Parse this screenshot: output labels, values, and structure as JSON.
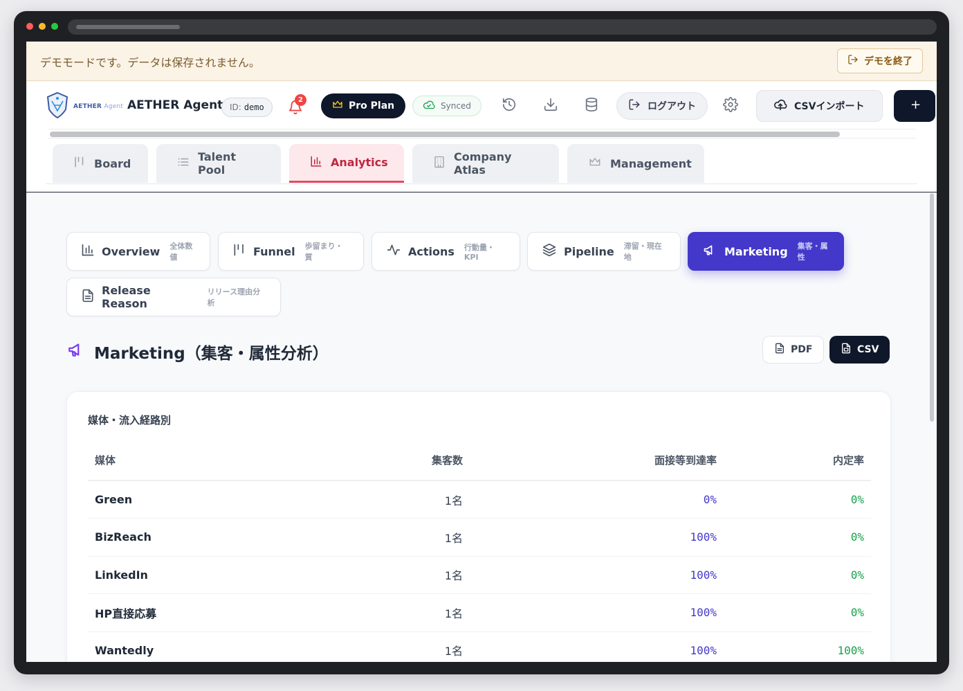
{
  "demo_banner": {
    "message": "デモモードです。データは保存されません。",
    "exit_label": "デモを終了"
  },
  "header": {
    "logo_text": "AETHER",
    "logo_sub": "Agent",
    "app_name": "AETHER Agent",
    "id_label": "ID:",
    "id_value": "demo",
    "notification_count": "2",
    "plan_label": "Pro Plan",
    "sync_label": "Synced",
    "logout_label": "ログアウト",
    "csv_import_label": "CSVインポート"
  },
  "main_tabs": [
    {
      "label": "Board",
      "icon": "columns-icon"
    },
    {
      "label": "Talent Pool",
      "icon": "list-icon"
    },
    {
      "label": "Analytics",
      "icon": "bar-chart-icon",
      "active": true
    },
    {
      "label": "Company Atlas",
      "icon": "building-icon"
    },
    {
      "label": "Management",
      "icon": "crown-icon"
    }
  ],
  "sub_tabs": [
    {
      "label": "Overview",
      "sub": "全体数値",
      "icon": "bar-chart-icon"
    },
    {
      "label": "Funnel",
      "sub": "歩留まり・質",
      "icon": "columns-icon"
    },
    {
      "label": "Actions",
      "sub": "行動量・KPI",
      "icon": "activity-icon"
    },
    {
      "label": "Pipeline",
      "sub": "滞留・現在地",
      "icon": "layers-icon"
    },
    {
      "label": "Marketing",
      "sub": "集客・属性",
      "icon": "megaphone-icon",
      "active": true
    },
    {
      "label": "Release Reason",
      "sub": "リリース理由分析",
      "icon": "document-icon"
    }
  ],
  "section": {
    "title": "Marketing（集客・属性分析）",
    "pdf_label": "PDF",
    "csv_label": "CSV"
  },
  "media_table": {
    "title": "媒体・流入経路別",
    "headers": [
      "媒体",
      "集客数",
      "面接等到達率",
      "内定率"
    ],
    "rows": [
      {
        "media": "Green",
        "count": "1名",
        "interview_rate": "0%",
        "offer_rate": "0%"
      },
      {
        "media": "BizReach",
        "count": "1名",
        "interview_rate": "100%",
        "offer_rate": "0%"
      },
      {
        "media": "LinkedIn",
        "count": "1名",
        "interview_rate": "100%",
        "offer_rate": "0%"
      },
      {
        "media": "HP直接応募",
        "count": "1名",
        "interview_rate": "100%",
        "offer_rate": "0%"
      },
      {
        "media": "Wantedly",
        "count": "1名",
        "interview_rate": "100%",
        "offer_rate": "100%"
      }
    ]
  },
  "colors": {
    "accent": "#4338ca",
    "analytics_tab": "#c0263e",
    "success": "#16a34a",
    "dark": "#0f172a"
  }
}
